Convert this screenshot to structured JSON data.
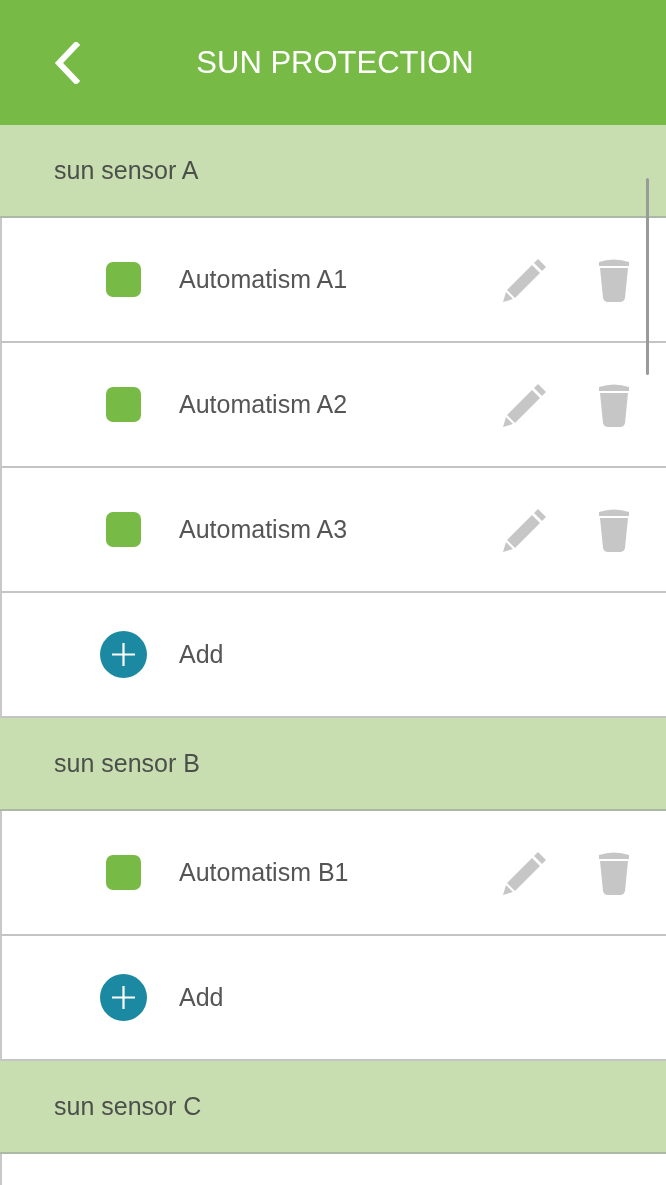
{
  "header": {
    "title": "SUN PROTECTION"
  },
  "sections": [
    {
      "title": "sun sensor A",
      "items": [
        {
          "kind": "automatism",
          "label": "Automatism A1"
        },
        {
          "kind": "automatism",
          "label": "Automatism A2"
        },
        {
          "kind": "automatism",
          "label": "Automatism A3"
        },
        {
          "kind": "add",
          "label": "Add"
        }
      ]
    },
    {
      "title": "sun sensor B",
      "items": [
        {
          "kind": "automatism",
          "label": "Automatism B1"
        },
        {
          "kind": "add",
          "label": "Add"
        }
      ]
    },
    {
      "title": "sun sensor C"
    }
  ]
}
